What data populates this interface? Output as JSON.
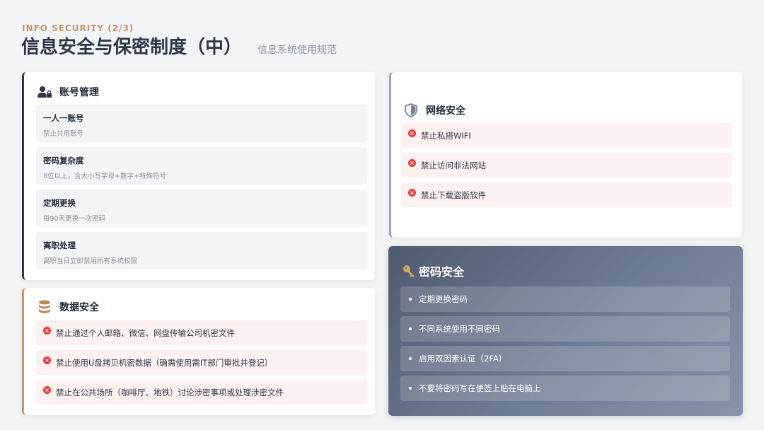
{
  "header": {
    "eyebrow": "INFO SECURITY (2/3)",
    "title": "信息安全与保密制度（中）",
    "subtitle": "信息系统使用规范"
  },
  "account": {
    "title": "账号管理",
    "icon": "user-lock-icon",
    "items": [
      {
        "name": "一人一账号",
        "desc": "禁止共用账号"
      },
      {
        "name": "密码复杂度",
        "desc": "8位以上，含大小写字母+数字+特殊符号"
      },
      {
        "name": "定期更换",
        "desc": "每90天更换一次密码"
      },
      {
        "name": "离职处理",
        "desc": "离职当日立即禁用所有系统权限"
      }
    ]
  },
  "data_security": {
    "title": "数据安全",
    "icon": "database-icon",
    "items": [
      "禁止通过个人邮箱、微信、网盘传输公司机密文件",
      "禁止使用U盘拷贝机密数据（确需使用需IT部门审批并登记）",
      "禁止在公共场所（咖啡厅、地铁）讨论涉密事项或处理涉密文件"
    ]
  },
  "network": {
    "title": "网络安全",
    "icon": "shield-icon",
    "items": [
      "禁止私搭WIFI",
      "禁止访问非法网站",
      "禁止下载盗版软件"
    ]
  },
  "password": {
    "title": "密码安全",
    "icon": "key-icon",
    "items": [
      "定期更换密码",
      "不同系统使用不同密码",
      "启用双因素认证（2FA）",
      "不要将密码写在便签上贴在电脑上"
    ]
  },
  "colors": {
    "accent_tan": "#c2956b",
    "dark": "#2d3748",
    "danger": "#e53e3e"
  }
}
